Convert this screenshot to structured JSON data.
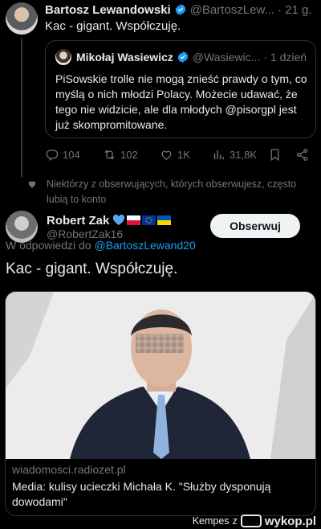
{
  "tweet1": {
    "author_name": "Bartosz Lewandowski",
    "author_handle": "@BartoszLew...",
    "time": "· 21 g.",
    "text": "Kac - gigant. Współczuję.",
    "quote": {
      "author_name": "Mikołaj Wasiewicz",
      "author_handle": "@Wasiewic...",
      "time": "· 1 dzień",
      "text": "PiSowskie trolle nie mogą znieść prawdy o tym, co myślą o nich młodzi Polacy. Możecie udawać, że tego nie widzicie, ale dla młodych @pisorgpl jest już skompromitowane."
    },
    "actions": {
      "replies": "104",
      "retweets": "102",
      "likes": "1K",
      "views": "31,8K"
    }
  },
  "social_context": "Niektórzy z obserwujących, których obserwujesz, często lubią to konto",
  "tweet2": {
    "author_name": "Robert Zak",
    "author_handle": "@RobertZak16",
    "follow_label": "Obserwuj",
    "reply_prefix": "W odpowiedzi do",
    "reply_to": "@BartoszLewand20",
    "text": "Kac - gigant. Współczuję.",
    "card": {
      "domain": "wiadomosci.radiozet.pl",
      "title": "Media: kulisy ucieczki Michała K. \"Służby dysponują dowodami\""
    }
  },
  "watermark": {
    "user": "Kempes",
    "connector": "z",
    "brand": "wykop.pl"
  },
  "icons": {
    "verified": "verified-badge-icon",
    "reply": "reply-icon",
    "retweet": "retweet-icon",
    "like": "heart-icon",
    "views": "views-icon",
    "bookmark": "bookmark-icon",
    "share": "share-icon"
  },
  "colors": {
    "background": "#000000",
    "text": "#e7e9ea",
    "secondary": "#71767b",
    "link": "#1d9bf0",
    "verified": "#1d9bf0",
    "border": "#2f3336"
  }
}
